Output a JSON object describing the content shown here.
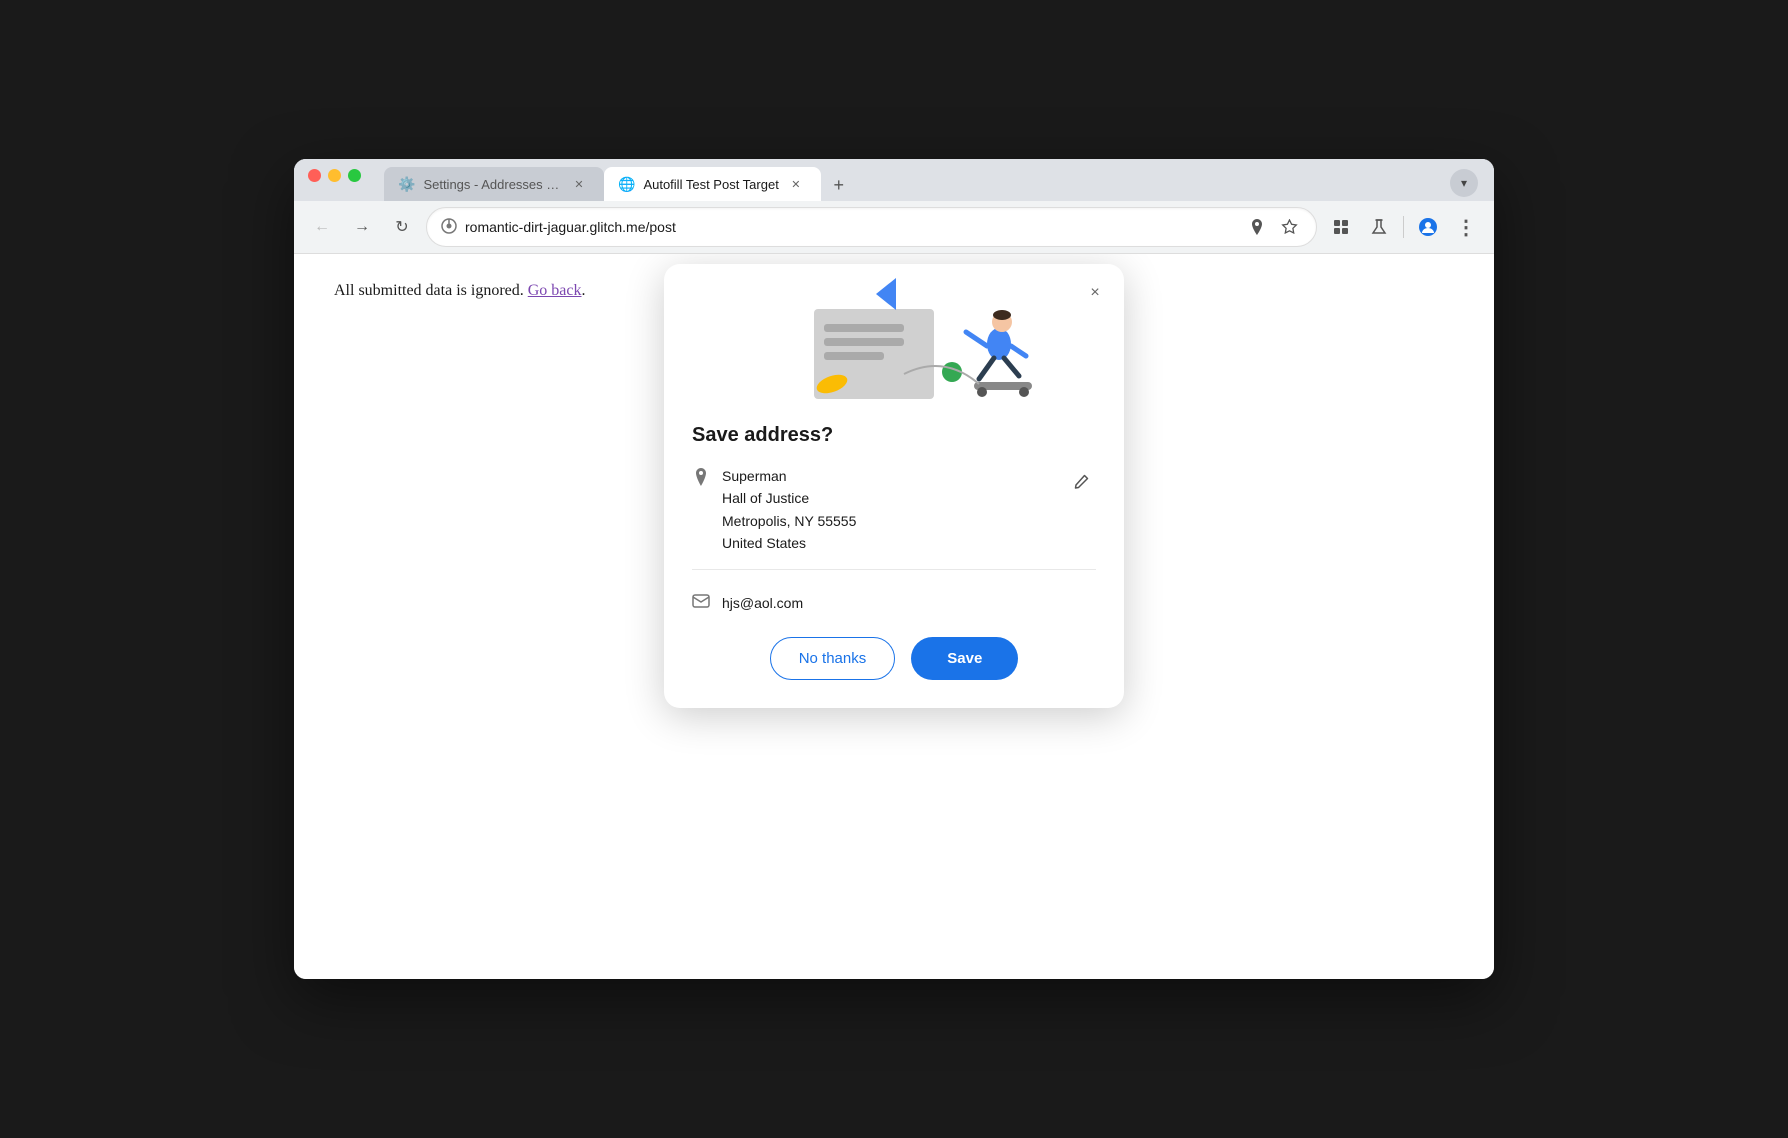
{
  "browser": {
    "tabs": [
      {
        "id": "tab-settings",
        "icon": "⚙️",
        "title": "Settings - Addresses and mo",
        "active": false
      },
      {
        "id": "tab-autofill",
        "icon": "🌐",
        "title": "Autofill Test Post Target",
        "active": true
      }
    ],
    "new_tab_label": "+",
    "chevron_label": "▾"
  },
  "toolbar": {
    "back_label": "←",
    "forward_label": "→",
    "reload_label": "↻",
    "address": "romantic-dirt-jaguar.glitch.me/post",
    "location_icon": "📍",
    "star_icon": "☆",
    "extensions_icon": "🧩",
    "labs_icon": "🧪",
    "profile_icon": "👤",
    "menu_icon": "⋮"
  },
  "page": {
    "content": "All submitted data is ignored.",
    "link_text": "Go back",
    "link_suffix": "."
  },
  "dialog": {
    "title": "Save address?",
    "close_label": "×",
    "address": {
      "name": "Superman",
      "line1": "Hall of Justice",
      "line2": "Metropolis, NY 55555",
      "line3": "United States"
    },
    "email": "hjs@aol.com",
    "no_thanks_label": "No thanks",
    "save_label": "Save"
  }
}
